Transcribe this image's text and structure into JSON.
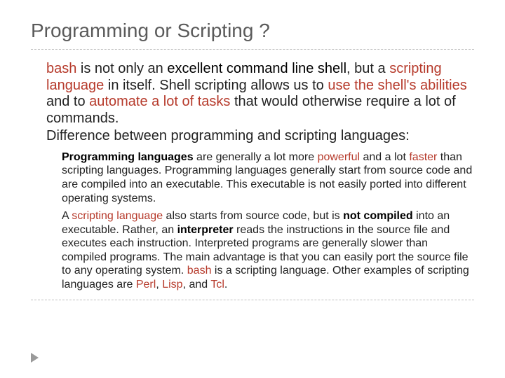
{
  "title": "Programming or Scripting ?",
  "bullets": {
    "outerStar": "",
    "innerStar": ""
  },
  "outer": [
    {
      "fragments": [
        {
          "text": "bash",
          "cls": "accent"
        },
        {
          "text": " is not only an "
        },
        {
          "text": "excellent command line shell",
          "cls": "black"
        },
        {
          "text": ", but a "
        },
        {
          "text": "scripting language",
          "cls": "accent"
        },
        {
          "text": " in itself. Shell scripting allows us to "
        },
        {
          "text": "use the shell's abilities",
          "cls": "accent"
        },
        {
          "text": " and to "
        },
        {
          "text": "automate a lot of tasks",
          "cls": "accent"
        },
        {
          "text": " that would otherwise require a lot of commands."
        }
      ]
    },
    {
      "fragments": [
        {
          "text": "Difference between programming and scripting languages:"
        }
      ]
    }
  ],
  "inner": [
    {
      "fragments": [
        {
          "text": "Programming languages",
          "cls": "black",
          "bold": true
        },
        {
          "text": " are generally a lot more "
        },
        {
          "text": "powerful",
          "cls": "accent"
        },
        {
          "text": " and a lot "
        },
        {
          "text": "faster",
          "cls": "accent"
        },
        {
          "text": " than scripting languages. Programming languages generally start from source code and are compiled into an executable. This executable is not easily ported into different operating systems."
        }
      ]
    },
    {
      "fragments": [
        {
          "text": "A "
        },
        {
          "text": "scripting language",
          "cls": "accent"
        },
        {
          "text": " also starts from source code, but is "
        },
        {
          "text": "not compiled",
          "cls": "black",
          "bold": true
        },
        {
          "text": " into an executable. Rather, an "
        },
        {
          "text": "interpreter",
          "cls": "black",
          "bold": true
        },
        {
          "text": " reads the instructions in the source file and executes each instruction. Interpreted programs are generally slower than compiled programs. The main advantage is that you can easily port the source file to any operating system. "
        },
        {
          "text": "bash",
          "cls": "accent"
        },
        {
          "text": " is a scripting language. Other examples of scripting languages are "
        },
        {
          "text": "Perl",
          "cls": "accent"
        },
        {
          "text": ", "
        },
        {
          "text": "Lisp",
          "cls": "accent"
        },
        {
          "text": ", and "
        },
        {
          "text": "Tcl",
          "cls": "accent"
        },
        {
          "text": "."
        }
      ]
    }
  ]
}
